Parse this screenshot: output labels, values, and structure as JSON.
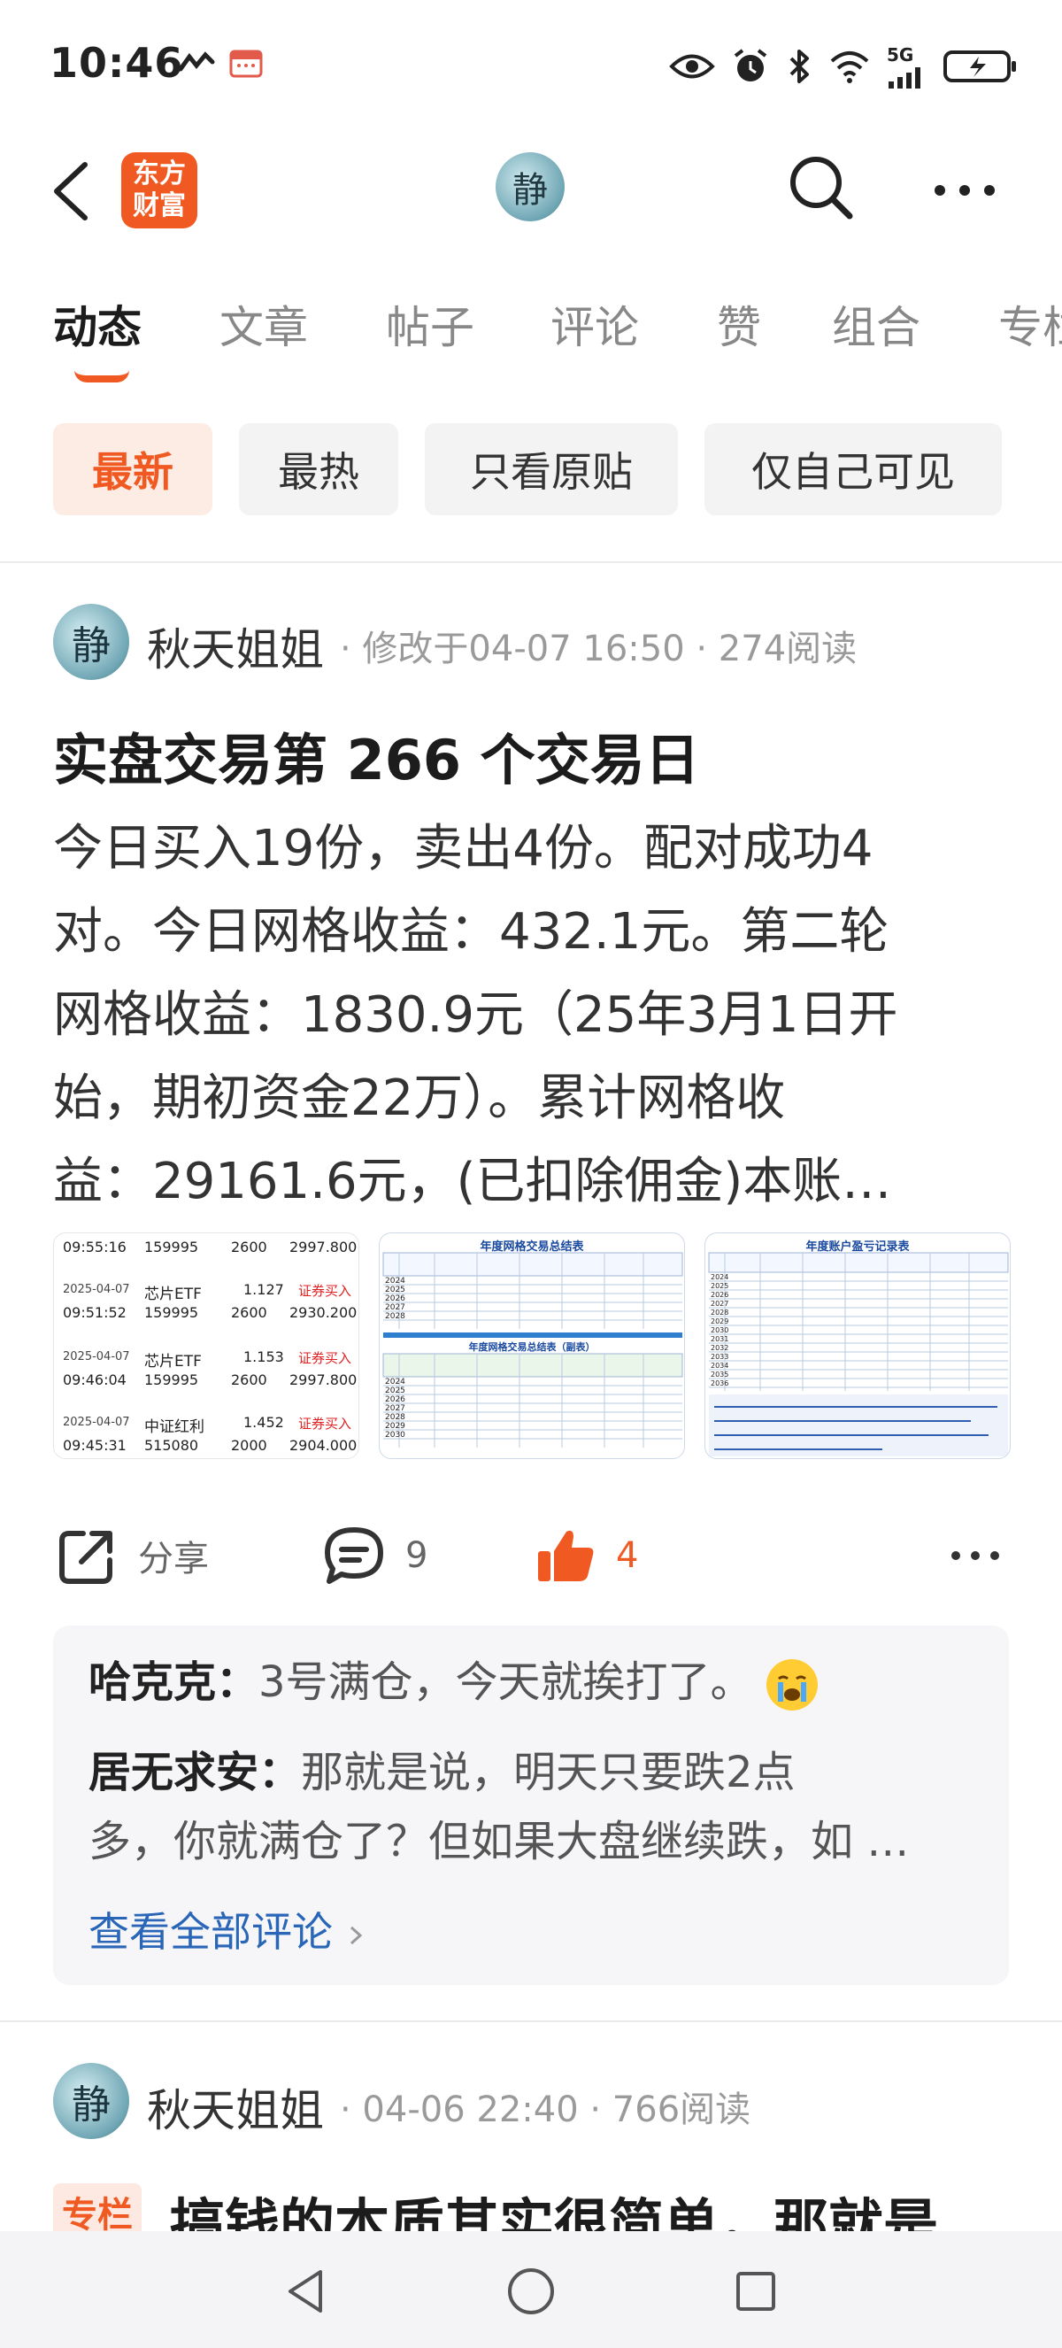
{
  "status_bar": {
    "time": "10:46",
    "network": "5G",
    "icons": [
      "link-icon",
      "calendar-icon",
      "eye-icon",
      "alarm-icon",
      "bluetooth-icon",
      "wifi-icon",
      "signal-icon",
      "battery-charging-icon"
    ]
  },
  "header": {
    "brand_line1": "东方",
    "brand_line2": "财富",
    "avatar_glyph": "静"
  },
  "tabs": [
    "动态",
    "文章",
    "帖子",
    "评论",
    "赞",
    "组合",
    "专栏"
  ],
  "active_tab": 0,
  "filters": [
    "最新",
    "最热",
    "只看原贴",
    "仅自己可见"
  ],
  "active_filter": 0,
  "post1": {
    "author": "秋天姐姐",
    "avatar_glyph": "静",
    "meta": "· 修改于04-07 16:50 · 274阅读",
    "title": "实盘交易第 266 个交易日",
    "body_lines": [
      "今日买入19份，卖出4份。配对成功4",
      "对。今日网格收益：432.1元。第二轮",
      "网格收益：1830.9元（25年3月1日开",
      "始，期初资金22万）。累计网格收",
      "益：29161.6元，(已扣除佣金)本账…"
    ],
    "thumb1": {
      "rows": [
        {
          "date": "",
          "time": "09:55:16",
          "name": "",
          "code": "159995",
          "price": "",
          "qty": "2600",
          "amount": "2997.800",
          "side": ""
        },
        {
          "date": "2025-04-07",
          "time": "09:51:52",
          "name": "芯片ETF",
          "code": "159995",
          "price": "1.127",
          "qty": "2600",
          "amount": "2930.200",
          "side": "证券买入"
        },
        {
          "date": "2025-04-07",
          "time": "09:46:04",
          "name": "芯片ETF",
          "code": "159995",
          "price": "1.153",
          "qty": "2600",
          "amount": "2997.800",
          "side": "证券买入"
        },
        {
          "date": "2025-04-07",
          "time": "09:45:31",
          "name": "中证红利",
          "code": "515080",
          "price": "1.452",
          "qty": "2000",
          "amount": "2904.000",
          "side": "证券买入"
        }
      ]
    },
    "thumb2": {
      "title1": "年度网格交易总结表",
      "title2": "年度网格交易总结表（副表）",
      "years": [
        "2024",
        "2025",
        "2026",
        "2027",
        "2028"
      ],
      "years2": [
        "2024",
        "2025",
        "2026",
        "2027",
        "2028",
        "2029",
        "2030"
      ]
    },
    "thumb3": {
      "title": "年度账户盈亏记录表",
      "years": [
        "2024",
        "2025",
        "2026",
        "2027",
        "2028",
        "2029",
        "2030",
        "2031",
        "2032",
        "2033",
        "2034",
        "2035",
        "2036"
      ]
    },
    "actions": {
      "share_label": "分享",
      "comment_count": "9",
      "like_count": "4"
    },
    "comments": [
      {
        "who": "哈克克：",
        "text": "3号满仓，今天就挨打了。"
      },
      {
        "who": "居无求安：",
        "text": "那就是说，明天只要跌2点"
      },
      {
        "who": "",
        "text": "多，你就满仓了？但如果大盘继续跌，如 …"
      }
    ],
    "view_all": "查看全部评论"
  },
  "post2": {
    "author": "秋天姐姐",
    "avatar_glyph": "静",
    "meta": "· 04-06 22:40 · 766阅读",
    "tag": "专栏",
    "title": "搞钱的本质其实很简单，那就是"
  },
  "colors": {
    "accent": "#f05a22",
    "link": "#2a66b8",
    "muted": "#9a9a9a"
  }
}
